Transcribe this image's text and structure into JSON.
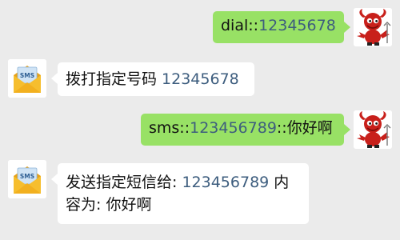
{
  "messages": [
    {
      "direction": "outgoing",
      "prefix": "dial::",
      "number": "12345678"
    },
    {
      "direction": "incoming",
      "text": "拨打指定号码 ",
      "number": "12345678",
      "avatar_label": "SMS"
    },
    {
      "direction": "outgoing",
      "prefix": "sms::",
      "number": "123456789",
      "suffix": "::你好啊"
    },
    {
      "direction": "incoming",
      "text": "发送指定短信给: ",
      "number": "123456789",
      "text_after_number": " 内",
      "text_line2": "容为: 你好啊",
      "avatar_label": "SMS"
    }
  ],
  "colors": {
    "background": "#ebebeb",
    "sent_bubble": "#98e165",
    "received_bubble": "#ffffff",
    "link_number": "#3d5d7e"
  },
  "icons": {
    "outgoing_avatar": "red-devil-mascot-icon",
    "incoming_avatar": "sms-envelope-icon"
  }
}
